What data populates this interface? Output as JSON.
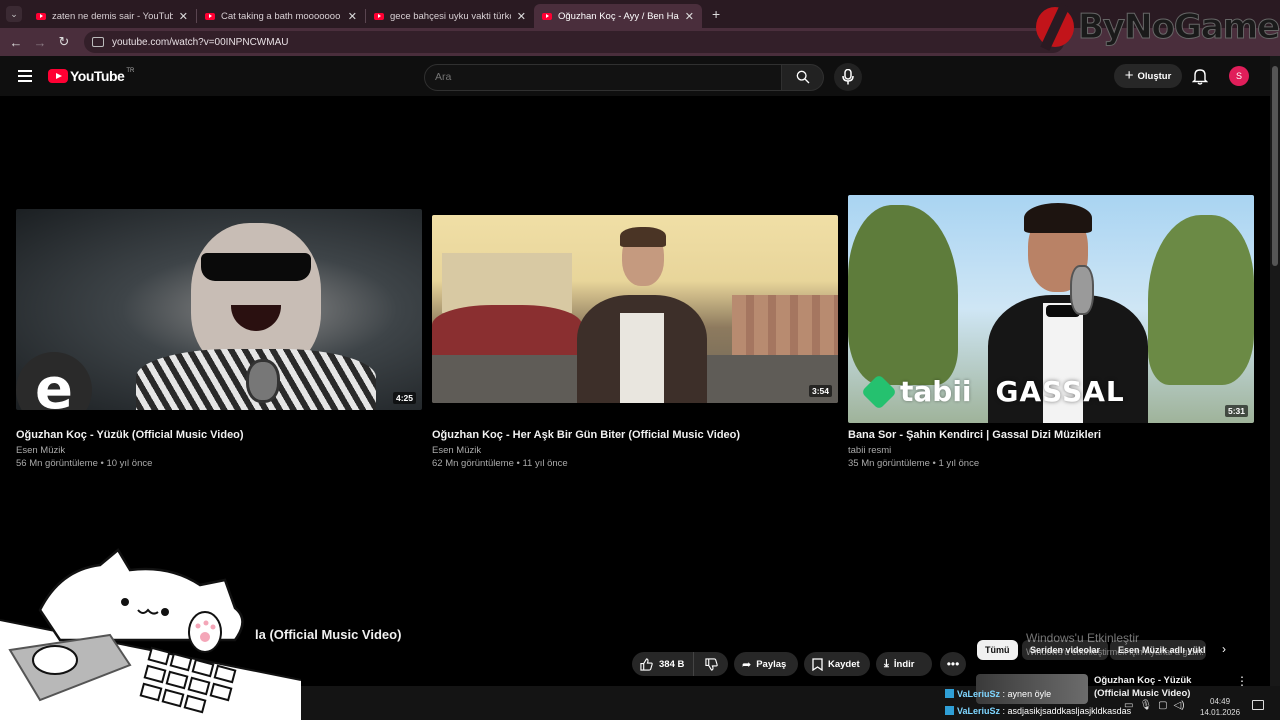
{
  "browser": {
    "tabs": [
      {
        "title": "zaten ne demis sair - YouTube",
        "active": false
      },
      {
        "title": "Cat taking a bath mooooooo m",
        "active": false
      },
      {
        "title": "gece bahçesi uyku vakti türkçe",
        "active": false
      },
      {
        "title": "Oğuzhan Koç - Ayy / Ben Halı",
        "active": true
      }
    ],
    "url": "youtube.com/watch?v=00INPNCWMAU",
    "new_tab": "+"
  },
  "watermark": {
    "text": "ByNoGame"
  },
  "youtube": {
    "logo": {
      "word": "YouTube",
      "region": "TR"
    },
    "search": {
      "placeholder": "Ara"
    },
    "create_label": "Oluştur",
    "avatar_letter": "S",
    "accent": "#ff0033",
    "avatar_color": "#e01e5a"
  },
  "videos": [
    {
      "title": "Oğuzhan Koç - Yüzük (Official Music Video)",
      "channel": "Esen Müzik",
      "meta": "56 Mn görüntüleme • 10 yıl önce",
      "duration": "4:25",
      "badge": "e"
    },
    {
      "title": "Oğuzhan Koç - Her Aşk Bir Gün Biter (Official Music Video)",
      "channel": "Esen Müzik",
      "meta": "62 Mn görüntüleme • 11 yıl önce",
      "duration": "3:54"
    },
    {
      "title": "Bana Sor - Şahin Kendirci | Gassal Dizi Müzikleri",
      "channel": "tabii resmi",
      "meta": "35 Mn görüntüleme • 1 yıl önce",
      "duration": "5:31",
      "brand": "tabii",
      "show": "GASSAL"
    }
  ],
  "player": {
    "title_partial": "la (Official Music Video)",
    "like_count": "384 B",
    "share_label": "Paylaş",
    "save_label": "Kaydet",
    "download_label": "İndir",
    "more_label": "•••"
  },
  "chips": [
    "Tümü",
    "Seriden videolar",
    "Esen Müzik adlı yükl"
  ],
  "activation": {
    "line1": "Windows'u Etkinleştir",
    "line2": "Windows'u etkinleştirmek için Ayarlar'a gidin."
  },
  "recommendation": {
    "title": "Oğuzhan Koç - Yüzük (Official Music Video)"
  },
  "chat": [
    {
      "user": "VaLeriuSz",
      "message": ": aynen öyle"
    },
    {
      "user": "VaLeriuSz",
      "message": ": asdjasikjsaddkasljasjkldkasdas"
    }
  ],
  "taskbar": {
    "time": "04:49",
    "date": "14.01.2026"
  }
}
